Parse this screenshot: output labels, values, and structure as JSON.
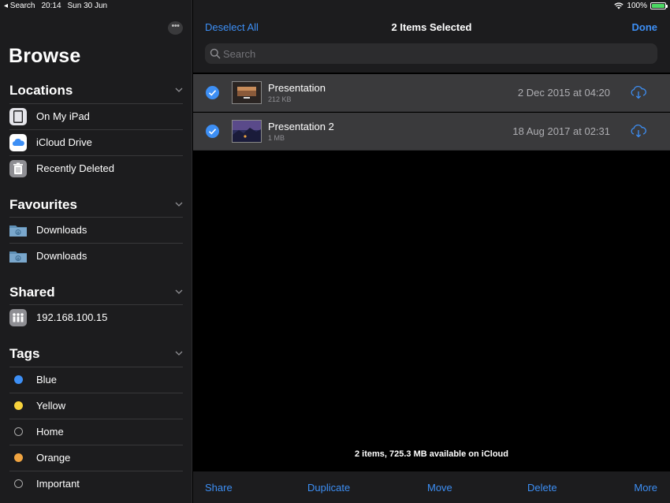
{
  "status": {
    "back_label": "◂ Search",
    "time": "20:14",
    "date": "Sun 30 Jun",
    "battery": "100%"
  },
  "sidebar": {
    "title": "Browse",
    "sections": {
      "locations": {
        "title": "Locations",
        "items": [
          "On My iPad",
          "iCloud Drive",
          "Recently Deleted"
        ]
      },
      "favourites": {
        "title": "Favourites",
        "items": [
          "Downloads",
          "Downloads"
        ]
      },
      "shared": {
        "title": "Shared",
        "items": [
          "192.168.100.15"
        ]
      },
      "tags": {
        "title": "Tags",
        "items": [
          {
            "label": "Blue",
            "color": "#3d8ff5"
          },
          {
            "label": "Yellow",
            "color": "#f7d23c"
          },
          {
            "label": "Home",
            "color": ""
          },
          {
            "label": "Orange",
            "color": "#f0a441"
          },
          {
            "label": "Important",
            "color": ""
          }
        ]
      }
    }
  },
  "header": {
    "deselect_label": "Deselect All",
    "title": "2 Items Selected",
    "done_label": "Done"
  },
  "search": {
    "placeholder": "Search"
  },
  "files": [
    {
      "name": "Presentation",
      "size": "212 KB",
      "date": "2 Dec 2015 at 04:20",
      "selected": true
    },
    {
      "name": "Presentation 2",
      "size": "1 MB",
      "date": "18 Aug 2017 at 02:31",
      "selected": true
    }
  ],
  "footer": {
    "info": "2 items, 725.3 MB available on iCloud"
  },
  "toolbar": {
    "share": "Share",
    "duplicate": "Duplicate",
    "move": "Move",
    "delete": "Delete",
    "more": "More"
  },
  "colors": {
    "accent": "#3d8ff5",
    "background": "#000000",
    "sidebar": "#1c1c1e"
  }
}
